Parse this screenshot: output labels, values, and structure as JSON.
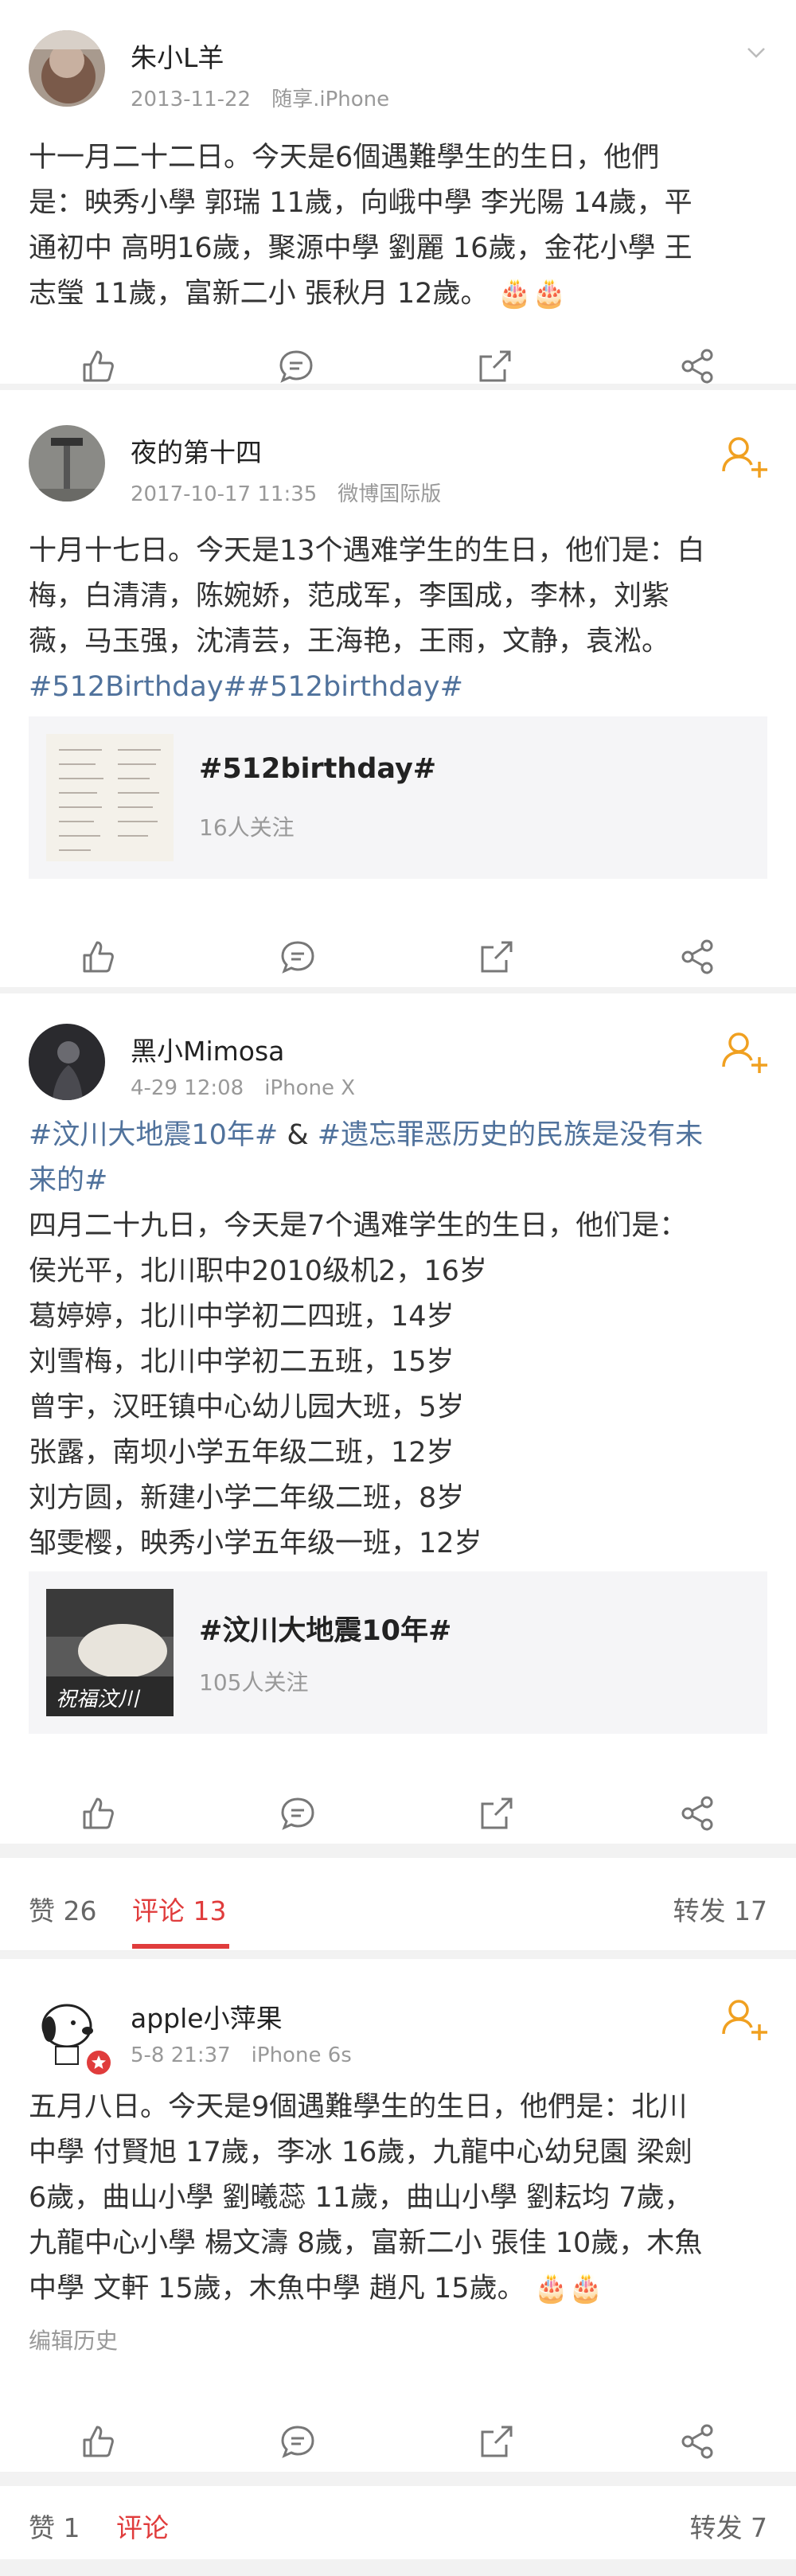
{
  "posts": [
    {
      "username": "朱小L羊",
      "date": "2013-11-22",
      "source": "随享.iPhone",
      "lines": [
        "十一月二十二日。今天是6個遇難學生的生日，他們",
        "是：映秀小學 郭瑞 11歲，向峨中學 李光陽 14歲，平",
        "通初中 高明16歲，聚源中學 劉麗 16歲，金花小學 王",
        "志瑩 11歲，富新二小 張秋月 12歲。"
      ]
    },
    {
      "username": "夜的第十四",
      "date": "2017-10-17 11:35",
      "source": "微博国际版",
      "lines": [
        "十月十七日。今天是13个遇难学生的生日，他们是：白",
        "梅，白清清，陈婉娇，范成军，李国成，李林，刘紫",
        "薇，马玉强，沈清芸，王海艳，王雨，文静，袁淞。"
      ],
      "hashtags": "#512Birthday##512birthday#",
      "card": {
        "title": "#512birthday#",
        "subtitle": "16人关注"
      }
    },
    {
      "username": "黑小Mimosa",
      "date": "4-29 12:08",
      "source": "iPhone X",
      "tag_a": "#汶川大地震10年#",
      "amp": " & ",
      "tag_b": "#遗忘罪恶历史的民族是没有未",
      "tag_b2": "来的#",
      "lines": [
        "四月二十九日，今天是7个遇难学生的生日，他们是：",
        "侯光平，北川职中2010级机2，16岁",
        "葛婷婷，北川中学初二四班，14岁",
        "刘雪梅，北川中学初二五班，15岁",
        "曾宇，汉旺镇中心幼儿园大班，5岁",
        "张露，南坝小学五年级二班，12岁",
        "刘方圆，新建小学二年级二班，8岁",
        "邹雯樱，映秀小学五年级一班，12岁"
      ],
      "card": {
        "title": "#汶川大地震10年#",
        "subtitle": "105人关注",
        "thumb_text": "祝福汶川"
      }
    },
    {
      "username": "apple小萍果",
      "date": "5-8 21:37",
      "source": "iPhone 6s",
      "lines": [
        "五月八日。今天是9個遇難學生的生日，他們是：北川",
        "中學 付賢旭 17歲，李冰 16歲，九龍中心幼兒園 梁劍",
        "6歲，曲山小學 劉曦蕊 11歲，曲山小學 劉耘均 7歲，",
        "九龍中心小學 楊文濤 8歲，富新二小 張佳 10歲，木魚",
        "中學 文軒 15歲，木魚中學 趙凡 15歲。"
      ],
      "edit_history": "编辑历史"
    }
  ],
  "tabs": {
    "likes": "赞 26",
    "comments": "评论 13",
    "reposts": "转发 17"
  },
  "tabs2": {
    "likes": "赞 1",
    "comments": "评论",
    "reposts": "转发 7"
  },
  "colors": {
    "accent_red": "#e03c3c",
    "link_blue": "#50729c",
    "follow_orange": "#f0a020"
  }
}
